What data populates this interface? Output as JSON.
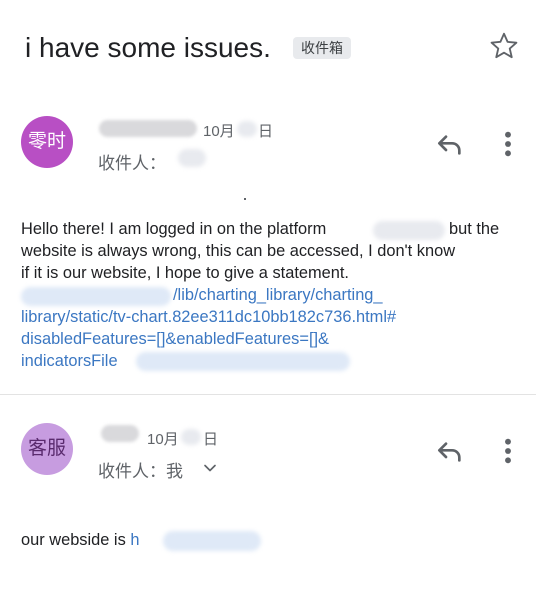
{
  "thread": {
    "subject": "i have some issues.",
    "label": "收件箱"
  },
  "messages": [
    {
      "avatar_text": "零时",
      "avatar_color": "#b84fc4",
      "date_prefix": "10月",
      "date_suffix": "日",
      "recipient_label": "收件人：",
      "body_lines": [
        "Hello there! I am logged in on the platform",
        "but the",
        "website is always wrong, this can be accessed, I don't know",
        "if it is our website, I hope to give a statement."
      ],
      "link_lines": [
        "/lib/charting_library/charting_",
        "library/static/tv-chart.82ee311dc10bb182c736.html#",
        "disabledFeatures=[]&enabledFeatures=[]&",
        "indicatorsFile"
      ]
    },
    {
      "avatar_text": "客服",
      "avatar_color": "#c79ce0",
      "date_prefix": "10月",
      "date_suffix": "日",
      "recipient_label": "收件人：我",
      "body_text": "our webside is ",
      "link_start": "h"
    }
  ],
  "colors": {
    "link": "#3b77c2",
    "text": "#202124",
    "muted": "#5f6368",
    "chip_bg": "#e8eaed"
  },
  "icons": [
    "star-icon",
    "reply-icon",
    "more-vert-icon",
    "chevron-down-icon"
  ]
}
